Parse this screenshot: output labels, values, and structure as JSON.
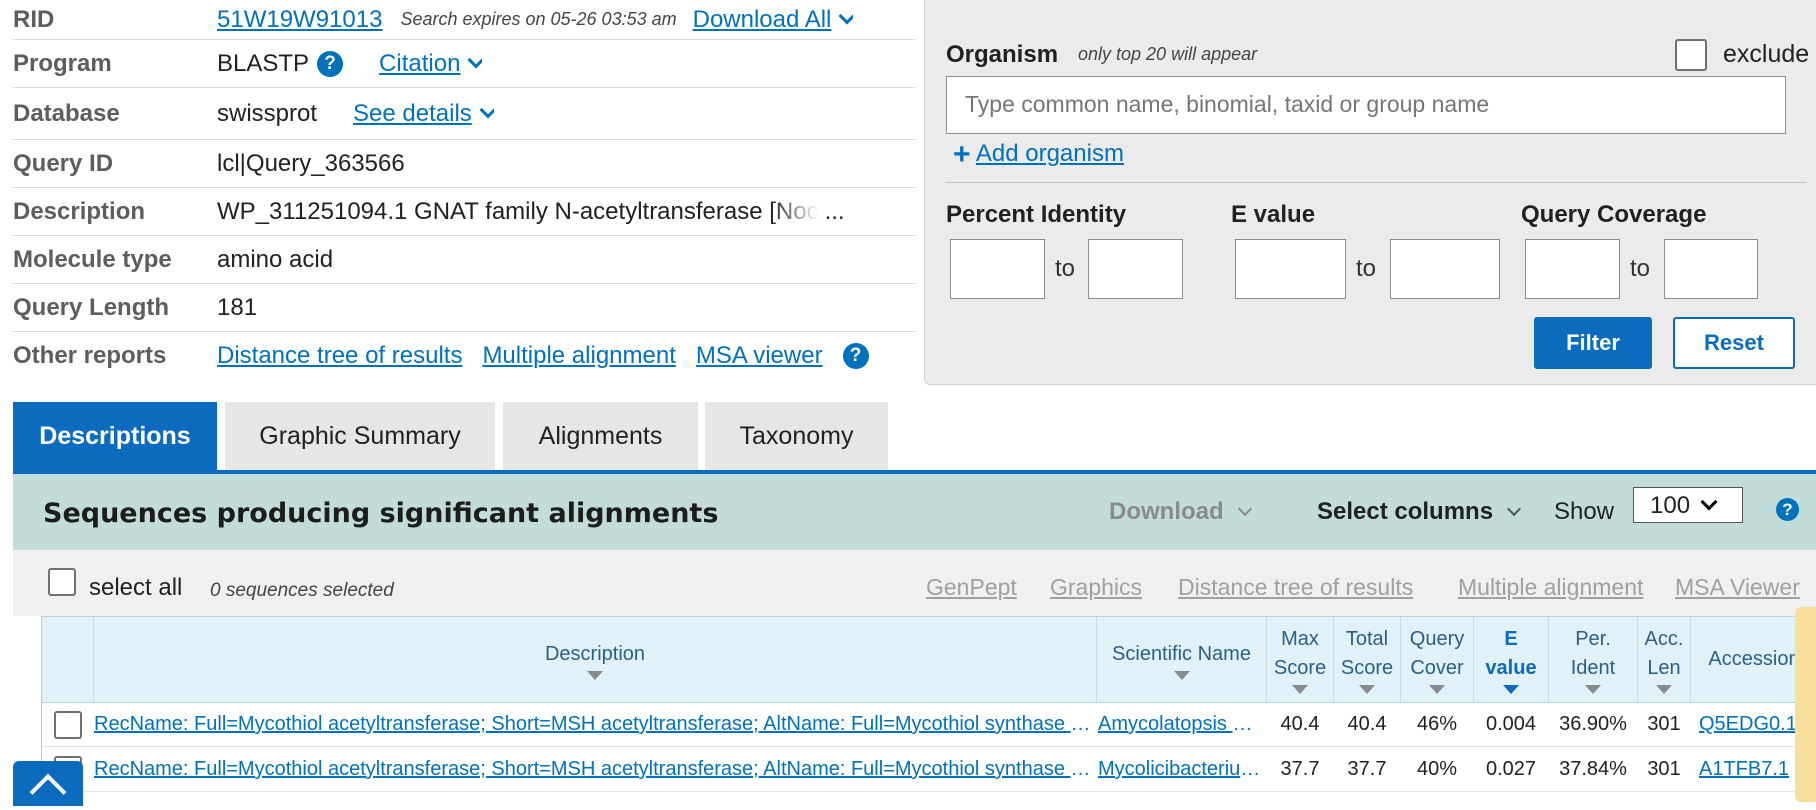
{
  "summary": {
    "rid": {
      "label": "RID",
      "value": "51W19W91013",
      "expires": "Search expires on 05-26 03:53 am",
      "download_all": "Download All"
    },
    "program": {
      "label": "Program",
      "value": "BLASTP",
      "help": "?",
      "citation": "Citation"
    },
    "database": {
      "label": "Database",
      "value": "swissprot",
      "see_details": "See details"
    },
    "query_id": {
      "label": "Query ID",
      "value": "lcl|Query_363566"
    },
    "description": {
      "label": "Description",
      "value": "WP_311251094.1 GNAT family N-acetyltransferase [Noc",
      "ellipsis": "..."
    },
    "molecule_type": {
      "label": "Molecule type",
      "value": "amino acid"
    },
    "query_length": {
      "label": "Query Length",
      "value": "181"
    },
    "other_reports": {
      "label": "Other reports",
      "links": [
        "Distance tree of results",
        "Multiple alignment",
        "MSA viewer"
      ],
      "help": "?"
    }
  },
  "filter": {
    "organism_label": "Organism",
    "organism_note": "only top 20 will appear",
    "exclude_label": "exclude",
    "organism_placeholder": "Type common  name, binomial, taxid or group  name",
    "add_organism": "Add organism",
    "percent_identity": "Percent Identity",
    "e_value": "E value",
    "query_coverage": "Query Coverage",
    "to": "to",
    "filter_button": "Filter",
    "reset_button": "Reset"
  },
  "tabs": [
    "Descriptions",
    "Graphic Summary",
    "Alignments",
    "Taxonomy"
  ],
  "results": {
    "title": "Sequences producing significant alignments",
    "download": "Download",
    "select_columns": "Select columns",
    "show": "Show",
    "show_value": "100",
    "help": "?"
  },
  "selection": {
    "select_all": "select all",
    "selected_count": "0 sequences selected",
    "links": [
      "GenPept",
      "Graphics",
      "Distance tree of results",
      "Multiple alignment",
      "MSA Viewer"
    ]
  },
  "table": {
    "headers": {
      "description": "Description",
      "scientific_name": "Scientific Name",
      "max_score": [
        "Max",
        "Score"
      ],
      "total_score": [
        "Total",
        "Score"
      ],
      "query_cover": [
        "Query",
        "Cover"
      ],
      "e_value": [
        "E",
        "value"
      ],
      "per_ident": [
        "Per.",
        "Ident"
      ],
      "acc_len": [
        "Acc.",
        "Len"
      ],
      "accession": "Accession"
    },
    "rows": [
      {
        "description": "RecName: Full=Mycothiol acetyltransferase; Short=MSH acetyltransferase; AltName: Full=Mycothiol synthase [Amycolatopsis mediterranei]",
        "scientific_name": "Amycolatopsis mediterranei",
        "max_score": "40.4",
        "total_score": "40.4",
        "query_cover": "46%",
        "e_value": "0.004",
        "per_ident": "36.90%",
        "acc_len": "301",
        "accession": "Q5EDG0.1"
      },
      {
        "description": "RecName: Full=Mycothiol acetyltransferase; Short=MSH acetyltransferase; AltName: Full=Mycothiol synthase [Mycolicibacterium vanbaalenii]",
        "scientific_name": "Mycolicibacterium vanbaalenii",
        "max_score": "37.7",
        "total_score": "37.7",
        "query_cover": "40%",
        "e_value": "0.027",
        "per_ident": "37.84%",
        "acc_len": "301",
        "accession": "A1TFB7.1"
      }
    ]
  },
  "colors": {
    "accent": "#0b6cbf",
    "link": "#0071bc",
    "results_bar": "#c2ddd9",
    "grid_header": "#e1f1f8"
  }
}
